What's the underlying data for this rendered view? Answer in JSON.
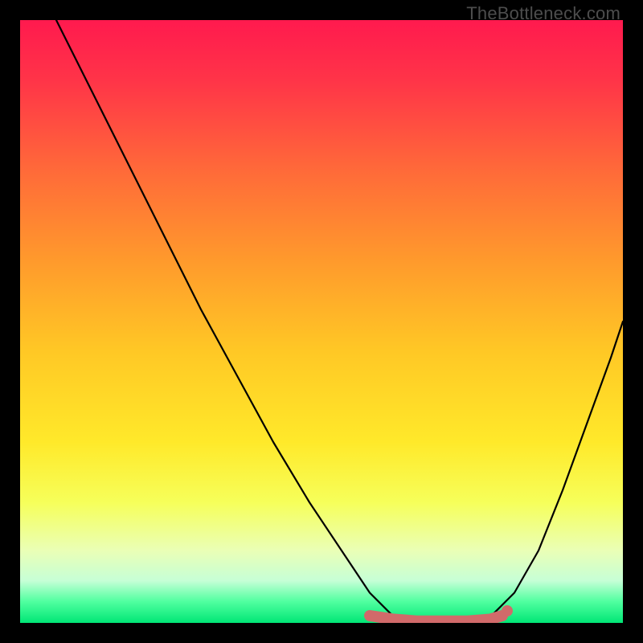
{
  "watermark": "TheBottleneck.com",
  "chart_data": {
    "type": "line",
    "title": "",
    "xlabel": "",
    "ylabel": "",
    "xlim": [
      0,
      100
    ],
    "ylim": [
      0,
      100
    ],
    "series": [
      {
        "name": "bottleneck-curve",
        "x": [
          0,
          6,
          12,
          18,
          24,
          30,
          36,
          42,
          48,
          54,
          58,
          62,
          66,
          70,
          74,
          78,
          82,
          86,
          90,
          94,
          98,
          100
        ],
        "y": [
          112,
          100,
          88,
          76,
          64,
          52,
          41,
          30,
          20,
          11,
          5,
          1,
          0,
          0,
          0,
          1,
          5,
          12,
          22,
          33,
          44,
          50
        ]
      },
      {
        "name": "optimal-range-marker",
        "x": [
          58,
          62,
          66,
          70,
          74,
          78,
          80
        ],
        "y": [
          1.2,
          0.6,
          0.3,
          0.3,
          0.3,
          0.6,
          1.2
        ]
      }
    ],
    "gradient_stops": [
      {
        "offset": 0.0,
        "color": "#ff1a4e"
      },
      {
        "offset": 0.1,
        "color": "#ff3448"
      },
      {
        "offset": 0.25,
        "color": "#ff6a39"
      },
      {
        "offset": 0.4,
        "color": "#ff9a2c"
      },
      {
        "offset": 0.55,
        "color": "#ffc825"
      },
      {
        "offset": 0.7,
        "color": "#ffe92a"
      },
      {
        "offset": 0.8,
        "color": "#f6ff5a"
      },
      {
        "offset": 0.88,
        "color": "#eaffb6"
      },
      {
        "offset": 0.93,
        "color": "#c6ffd6"
      },
      {
        "offset": 0.965,
        "color": "#4fff9f"
      },
      {
        "offset": 1.0,
        "color": "#00e676"
      }
    ],
    "curve_color": "#000000",
    "marker_color": "#d16a6a"
  }
}
